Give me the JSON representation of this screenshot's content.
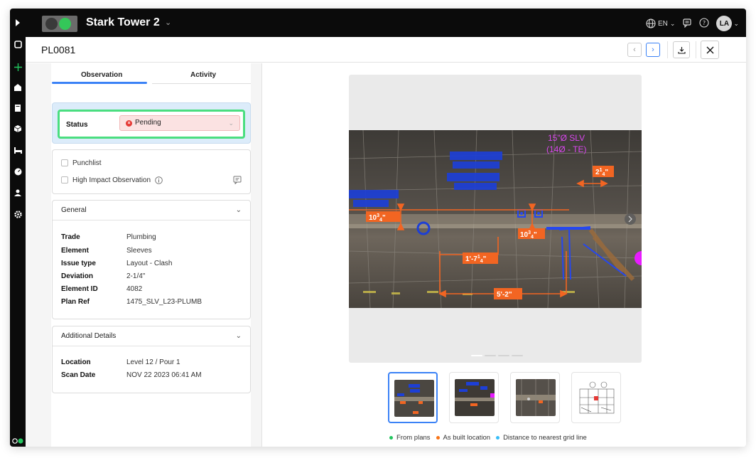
{
  "header": {
    "project_name": "Stark Tower 2",
    "language": "EN",
    "user_initials": "LA"
  },
  "record": {
    "id": "PL0081"
  },
  "tabs": [
    {
      "label": "Observation"
    },
    {
      "label": "Activity"
    }
  ],
  "status": {
    "label": "Status",
    "value": "Pending",
    "color": "#e53935"
  },
  "flags": {
    "punchlist": "Punchlist",
    "high_impact": "High Impact Observation"
  },
  "general": {
    "title": "General",
    "rows": [
      {
        "key": "Trade",
        "value": "Plumbing"
      },
      {
        "key": "Element",
        "value": "Sleeves"
      },
      {
        "key": "Issue type",
        "value": "Layout - Clash"
      },
      {
        "key": "Deviation",
        "value": "2-1/4\""
      },
      {
        "key": "Element ID",
        "value": "4082"
      },
      {
        "key": "Plan Ref",
        "value": "1475_SLV_L23-PLUMB"
      }
    ]
  },
  "additional": {
    "title": "Additional Details",
    "rows": [
      {
        "key": "Location",
        "value": "Level 12 / Pour 1"
      },
      {
        "key": "Scan Date",
        "value": "NOV 22 2023 06:41 AM"
      }
    ]
  },
  "scan_annotations": {
    "magenta_line1": "15\"Ø SLV",
    "magenta_line2": "(14Ø - TE)",
    "dim1_main": "10",
    "dim1_sup": "3",
    "dim1_sub": "4",
    "dim2_main": "10",
    "dim2_sup": "3",
    "dim2_sub": "4",
    "dim3_main": "2",
    "dim3_sup": "1",
    "dim3_sub": "4",
    "dim4_main": "1'-7",
    "dim4_sup": "1",
    "dim4_sub": "4",
    "dim5": "5'-2\""
  },
  "legend": [
    {
      "label": "From plans",
      "color": "#22c55e"
    },
    {
      "label": "As built location",
      "color": "#f97316"
    },
    {
      "label": "Distance to nearest grid line",
      "color": "#38bdf8"
    }
  ],
  "colors": {
    "accent": "#3b82f6",
    "highlight": "#4ade80",
    "dimension": "#f26522",
    "plan_blue": "#1d3fd6",
    "magenta": "#d946ef"
  }
}
